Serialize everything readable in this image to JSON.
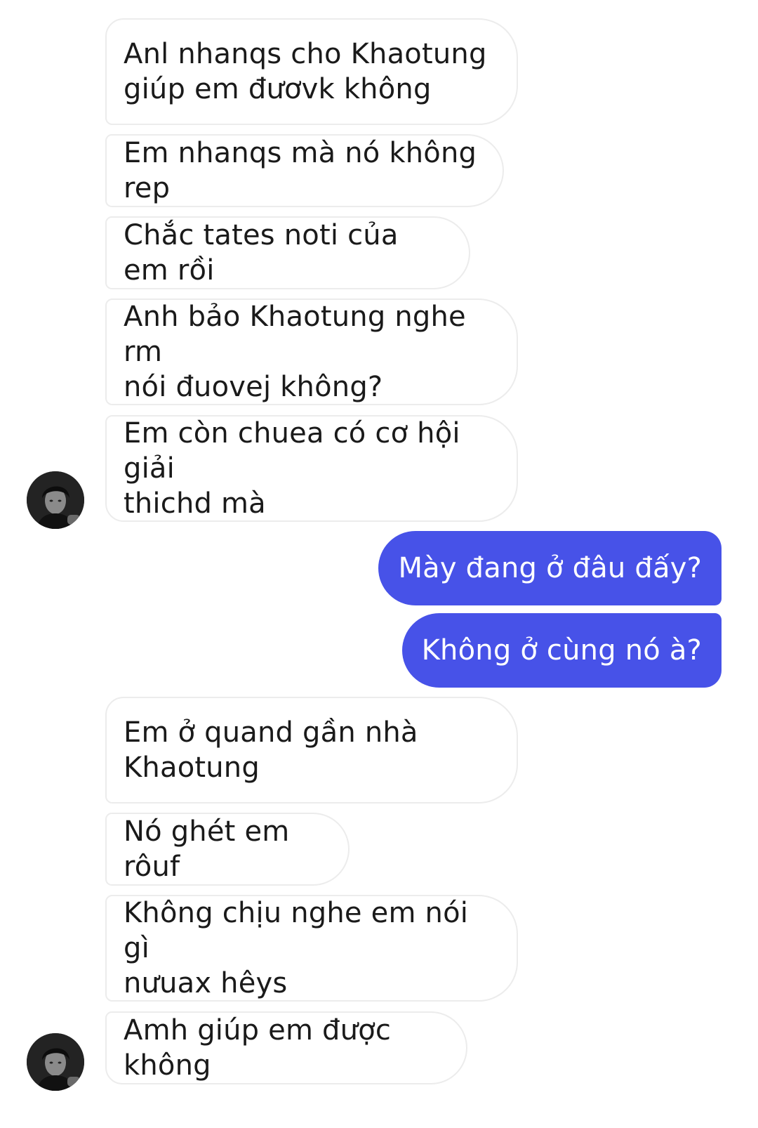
{
  "messages": [
    {
      "side": "in",
      "text": "Anl nhanqs cho Khaotung\ngiúp em đươvk không"
    },
    {
      "side": "in",
      "text": "Em nhanqs mà nó không rep"
    },
    {
      "side": "in",
      "text": "Chắc tates noti của em rồi"
    },
    {
      "side": "in",
      "text": "Anh bảo Khaotung nghe rm\nnói đuovej không?"
    },
    {
      "side": "in",
      "text": "Em còn chuea có cơ hội giải\nthichd mà"
    },
    {
      "side": "out",
      "text": "Mày đang ở đâu đấy?"
    },
    {
      "side": "out",
      "text": "Không ở cùng nó à?"
    },
    {
      "side": "in",
      "text": "Em ở quand gần nhà\nKhaotung"
    },
    {
      "side": "in",
      "text": "Nó ghét em rôuf"
    },
    {
      "side": "in",
      "text": "Không chịu nghe em nói gì\nnưuax hêys"
    },
    {
      "side": "in",
      "text": "Amh giúp em được không"
    }
  ],
  "colors": {
    "outgoing_bubble": "#4752e8",
    "incoming_bubble": "#ffffff",
    "incoming_border": "#ececec"
  },
  "icons": {
    "avatar": "contact-avatar-photo"
  }
}
